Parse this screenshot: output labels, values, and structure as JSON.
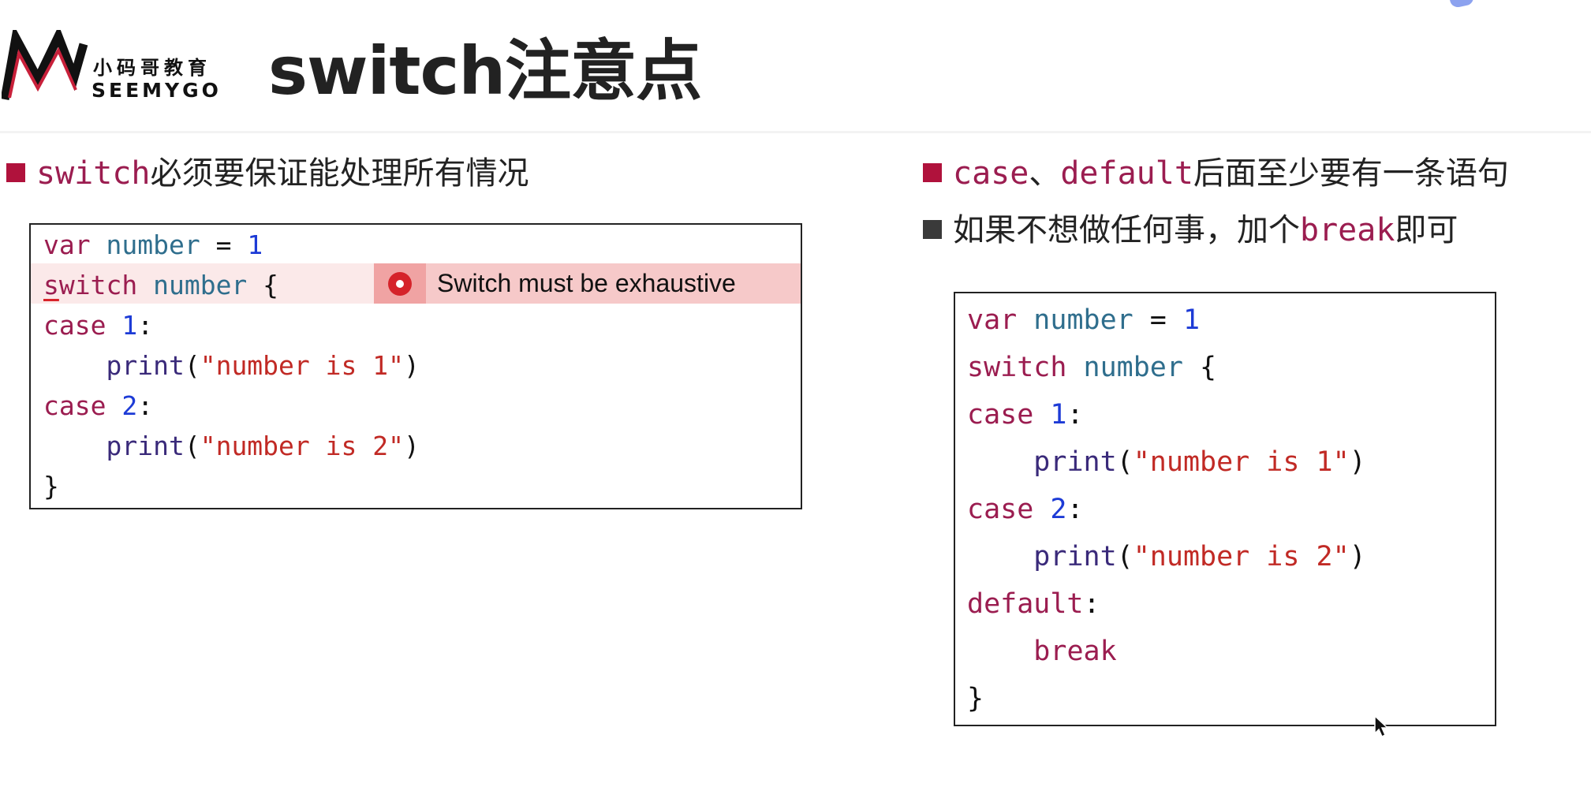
{
  "header": {
    "logo_cn": "小码哥教育",
    "logo_en": "SEEMYGO",
    "title": "switch注意点"
  },
  "left": {
    "bullet": {
      "kw": "switch",
      "text": "必须要保证能处理所有情况"
    },
    "code": [
      [
        {
          "t": "var",
          "c": "kw"
        },
        {
          "t": " ",
          "c": "plain"
        },
        {
          "t": "number",
          "c": "var"
        },
        {
          "t": " = ",
          "c": "plain"
        },
        {
          "t": "1",
          "c": "num"
        }
      ],
      [
        {
          "t": "s",
          "c": "kw-err"
        },
        {
          "t": "witch",
          "c": "kw"
        },
        {
          "t": " ",
          "c": "plain"
        },
        {
          "t": "number",
          "c": "var"
        },
        {
          "t": " {",
          "c": "plain"
        }
      ],
      [
        {
          "t": "case",
          "c": "kw"
        },
        {
          "t": " ",
          "c": "plain"
        },
        {
          "t": "1",
          "c": "num"
        },
        {
          "t": ":",
          "c": "plain"
        }
      ],
      [
        {
          "t": "    ",
          "c": "plain"
        },
        {
          "t": "print",
          "c": "fn"
        },
        {
          "t": "(",
          "c": "plain"
        },
        {
          "t": "\"number is 1\"",
          "c": "str"
        },
        {
          "t": ")",
          "c": "plain"
        }
      ],
      [
        {
          "t": "case",
          "c": "kw"
        },
        {
          "t": " ",
          "c": "plain"
        },
        {
          "t": "2",
          "c": "num"
        },
        {
          "t": ":",
          "c": "plain"
        }
      ],
      [
        {
          "t": "    ",
          "c": "plain"
        },
        {
          "t": "print",
          "c": "fn"
        },
        {
          "t": "(",
          "c": "plain"
        },
        {
          "t": "\"number is 2\"",
          "c": "str"
        },
        {
          "t": ")",
          "c": "plain"
        }
      ],
      [
        {
          "t": "}",
          "c": "plain"
        }
      ]
    ],
    "error_message": "Switch must be exhaustive"
  },
  "right": {
    "bullet1": {
      "kw1": "case",
      "sep": "、",
      "kw2": "default",
      "text": "后面至少要有一条语句"
    },
    "bullet2": {
      "pre": "如果不想做任何事，加个",
      "kw": "break",
      "post": "即可"
    },
    "code": [
      [
        {
          "t": "var",
          "c": "kw"
        },
        {
          "t": " ",
          "c": "plain"
        },
        {
          "t": "number",
          "c": "var"
        },
        {
          "t": " = ",
          "c": "plain"
        },
        {
          "t": "1",
          "c": "num"
        }
      ],
      [
        {
          "t": "switch",
          "c": "kw"
        },
        {
          "t": " ",
          "c": "plain"
        },
        {
          "t": "number",
          "c": "var"
        },
        {
          "t": " {",
          "c": "plain"
        }
      ],
      [
        {
          "t": "case",
          "c": "kw"
        },
        {
          "t": " ",
          "c": "plain"
        },
        {
          "t": "1",
          "c": "num"
        },
        {
          "t": ":",
          "c": "plain"
        }
      ],
      [
        {
          "t": "    ",
          "c": "plain"
        },
        {
          "t": "print",
          "c": "fn"
        },
        {
          "t": "(",
          "c": "plain"
        },
        {
          "t": "\"number is 1\"",
          "c": "str"
        },
        {
          "t": ")",
          "c": "plain"
        }
      ],
      [
        {
          "t": "case",
          "c": "kw"
        },
        {
          "t": " ",
          "c": "plain"
        },
        {
          "t": "2",
          "c": "num"
        },
        {
          "t": ":",
          "c": "plain"
        }
      ],
      [
        {
          "t": "    ",
          "c": "plain"
        },
        {
          "t": "print",
          "c": "fn"
        },
        {
          "t": "(",
          "c": "plain"
        },
        {
          "t": "\"number is 2\"",
          "c": "str"
        },
        {
          "t": ")",
          "c": "plain"
        }
      ],
      [
        {
          "t": "default",
          "c": "kw"
        },
        {
          "t": ":",
          "c": "plain"
        }
      ],
      [
        {
          "t": "    ",
          "c": "plain"
        },
        {
          "t": "break",
          "c": "kw"
        }
      ],
      [
        {
          "t": "}",
          "c": "plain"
        }
      ]
    ]
  },
  "colors": {
    "bullet_red": "#b0123c",
    "keyword": "#9b1d50",
    "variable": "#2f6e8d",
    "number": "#1d3bd6",
    "string": "#c12a25",
    "error_icon": "#d5232a"
  },
  "icons": {
    "logo": "seemygo-logo",
    "error": "error-circle-icon",
    "cursor": "mouse-pointer-icon"
  }
}
